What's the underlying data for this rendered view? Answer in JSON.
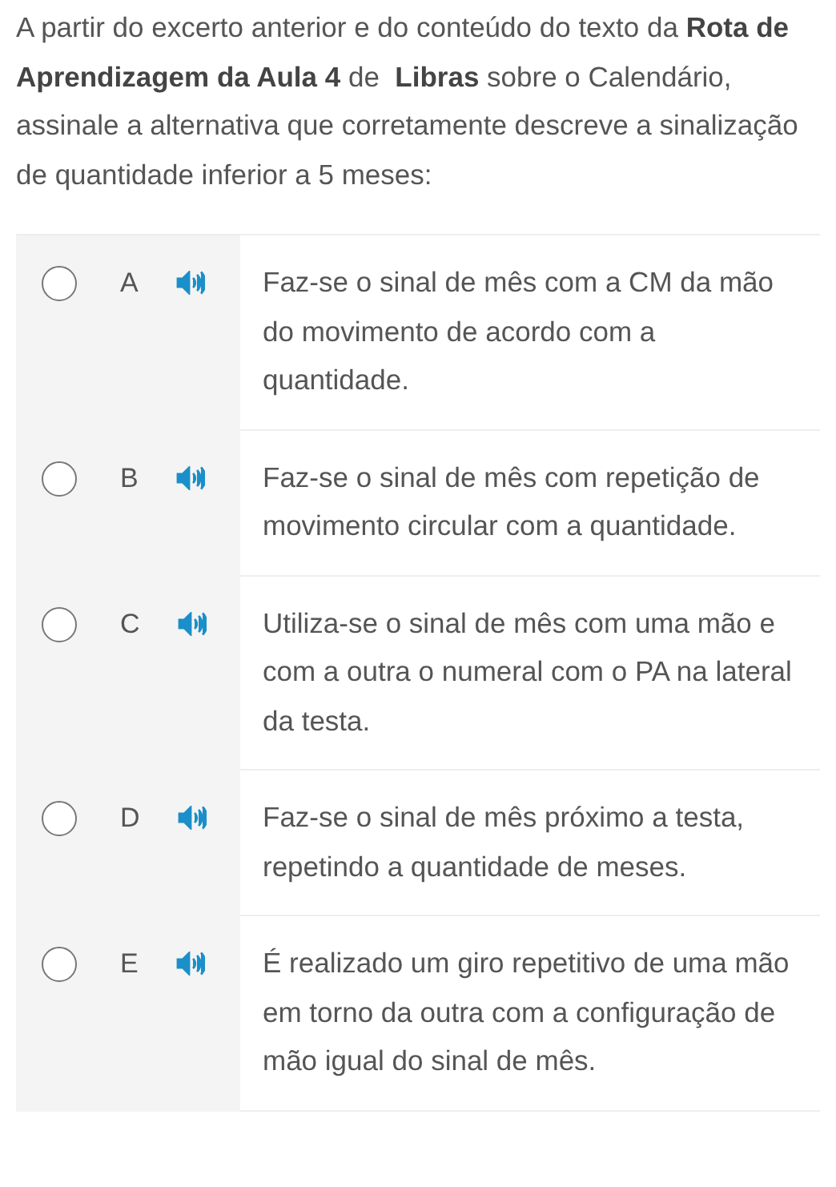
{
  "question": "A partir do excerto anterior e do conteúdo do texto da **Rota de Aprendizagem da Aula 4** de  **Libras** sobre o Calendário, assinale a alternativa que corretamente descreve a sinalização de quantidade inferior a 5 meses:",
  "options": [
    {
      "letter": "A",
      "text": "Faz-se o sinal de mês com a CM da mão do movimento de acordo com a quantidade.",
      "selected": false
    },
    {
      "letter": "B",
      "text": "Faz-se o sinal de mês com repetição de movimento circular com a quantidade.",
      "selected": false
    },
    {
      "letter": "C",
      "text": "Utiliza-se o sinal de mês com uma mão e com a outra o numeral com o PA na lateral da testa.",
      "selected": false
    },
    {
      "letter": "D",
      "text": "Faz-se o sinal de mês próximo a testa, repetindo a quantidade de meses.",
      "selected": false
    },
    {
      "letter": "E",
      "text": "É realizado um giro repetitivo de uma mão em torno da outra com a configuração de mão igual do sinal de mês.",
      "selected": false
    }
  ]
}
